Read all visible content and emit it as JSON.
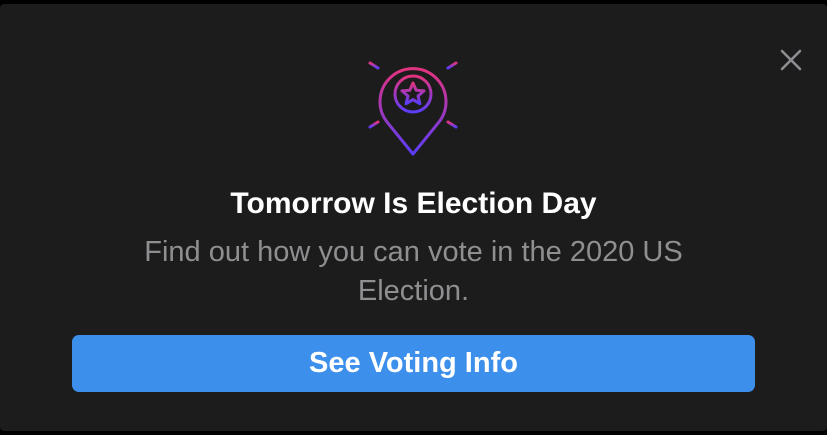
{
  "card": {
    "title": "Tomorrow Is Election Day",
    "subtitle": "Find out how you can vote in the 2020 US Election.",
    "cta_label": "See Voting Info",
    "close_icon": "close-icon",
    "badge_icon": "location-pin-star-icon"
  },
  "colors": {
    "background": "#1c1c1d",
    "title": "#ffffff",
    "subtitle": "#8f8f92",
    "button": "#3c8fea",
    "button_text": "#ffffff",
    "icon_gradient_top": "#e2337e",
    "icon_gradient_bottom": "#5b3dfa",
    "close": "#8e8e92"
  }
}
